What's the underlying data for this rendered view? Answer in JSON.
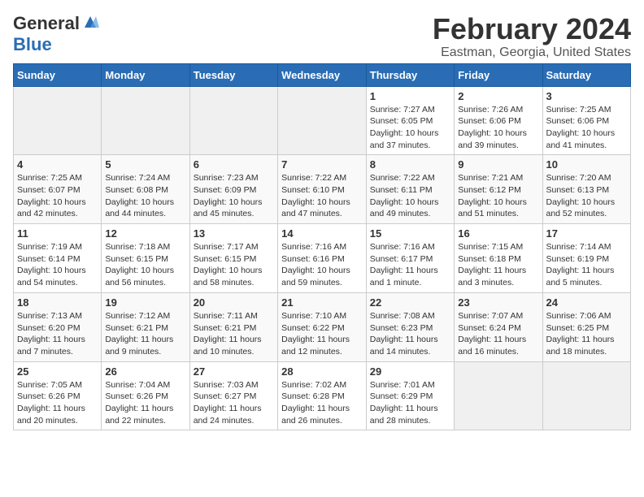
{
  "logo": {
    "general": "General",
    "blue": "Blue"
  },
  "title": "February 2024",
  "subtitle": "Eastman, Georgia, United States",
  "weekdays": [
    "Sunday",
    "Monday",
    "Tuesday",
    "Wednesday",
    "Thursday",
    "Friday",
    "Saturday"
  ],
  "weeks": [
    [
      {
        "day": "",
        "sunrise": "",
        "sunset": "",
        "daylight": ""
      },
      {
        "day": "",
        "sunrise": "",
        "sunset": "",
        "daylight": ""
      },
      {
        "day": "",
        "sunrise": "",
        "sunset": "",
        "daylight": ""
      },
      {
        "day": "",
        "sunrise": "",
        "sunset": "",
        "daylight": ""
      },
      {
        "day": "1",
        "sunrise": "Sunrise: 7:27 AM",
        "sunset": "Sunset: 6:05 PM",
        "daylight": "Daylight: 10 hours and 37 minutes."
      },
      {
        "day": "2",
        "sunrise": "Sunrise: 7:26 AM",
        "sunset": "Sunset: 6:06 PM",
        "daylight": "Daylight: 10 hours and 39 minutes."
      },
      {
        "day": "3",
        "sunrise": "Sunrise: 7:25 AM",
        "sunset": "Sunset: 6:06 PM",
        "daylight": "Daylight: 10 hours and 41 minutes."
      }
    ],
    [
      {
        "day": "4",
        "sunrise": "Sunrise: 7:25 AM",
        "sunset": "Sunset: 6:07 PM",
        "daylight": "Daylight: 10 hours and 42 minutes."
      },
      {
        "day": "5",
        "sunrise": "Sunrise: 7:24 AM",
        "sunset": "Sunset: 6:08 PM",
        "daylight": "Daylight: 10 hours and 44 minutes."
      },
      {
        "day": "6",
        "sunrise": "Sunrise: 7:23 AM",
        "sunset": "Sunset: 6:09 PM",
        "daylight": "Daylight: 10 hours and 45 minutes."
      },
      {
        "day": "7",
        "sunrise": "Sunrise: 7:22 AM",
        "sunset": "Sunset: 6:10 PM",
        "daylight": "Daylight: 10 hours and 47 minutes."
      },
      {
        "day": "8",
        "sunrise": "Sunrise: 7:22 AM",
        "sunset": "Sunset: 6:11 PM",
        "daylight": "Daylight: 10 hours and 49 minutes."
      },
      {
        "day": "9",
        "sunrise": "Sunrise: 7:21 AM",
        "sunset": "Sunset: 6:12 PM",
        "daylight": "Daylight: 10 hours and 51 minutes."
      },
      {
        "day": "10",
        "sunrise": "Sunrise: 7:20 AM",
        "sunset": "Sunset: 6:13 PM",
        "daylight": "Daylight: 10 hours and 52 minutes."
      }
    ],
    [
      {
        "day": "11",
        "sunrise": "Sunrise: 7:19 AM",
        "sunset": "Sunset: 6:14 PM",
        "daylight": "Daylight: 10 hours and 54 minutes."
      },
      {
        "day": "12",
        "sunrise": "Sunrise: 7:18 AM",
        "sunset": "Sunset: 6:15 PM",
        "daylight": "Daylight: 10 hours and 56 minutes."
      },
      {
        "day": "13",
        "sunrise": "Sunrise: 7:17 AM",
        "sunset": "Sunset: 6:15 PM",
        "daylight": "Daylight: 10 hours and 58 minutes."
      },
      {
        "day": "14",
        "sunrise": "Sunrise: 7:16 AM",
        "sunset": "Sunset: 6:16 PM",
        "daylight": "Daylight: 10 hours and 59 minutes."
      },
      {
        "day": "15",
        "sunrise": "Sunrise: 7:16 AM",
        "sunset": "Sunset: 6:17 PM",
        "daylight": "Daylight: 11 hours and 1 minute."
      },
      {
        "day": "16",
        "sunrise": "Sunrise: 7:15 AM",
        "sunset": "Sunset: 6:18 PM",
        "daylight": "Daylight: 11 hours and 3 minutes."
      },
      {
        "day": "17",
        "sunrise": "Sunrise: 7:14 AM",
        "sunset": "Sunset: 6:19 PM",
        "daylight": "Daylight: 11 hours and 5 minutes."
      }
    ],
    [
      {
        "day": "18",
        "sunrise": "Sunrise: 7:13 AM",
        "sunset": "Sunset: 6:20 PM",
        "daylight": "Daylight: 11 hours and 7 minutes."
      },
      {
        "day": "19",
        "sunrise": "Sunrise: 7:12 AM",
        "sunset": "Sunset: 6:21 PM",
        "daylight": "Daylight: 11 hours and 9 minutes."
      },
      {
        "day": "20",
        "sunrise": "Sunrise: 7:11 AM",
        "sunset": "Sunset: 6:21 PM",
        "daylight": "Daylight: 11 hours and 10 minutes."
      },
      {
        "day": "21",
        "sunrise": "Sunrise: 7:10 AM",
        "sunset": "Sunset: 6:22 PM",
        "daylight": "Daylight: 11 hours and 12 minutes."
      },
      {
        "day": "22",
        "sunrise": "Sunrise: 7:08 AM",
        "sunset": "Sunset: 6:23 PM",
        "daylight": "Daylight: 11 hours and 14 minutes."
      },
      {
        "day": "23",
        "sunrise": "Sunrise: 7:07 AM",
        "sunset": "Sunset: 6:24 PM",
        "daylight": "Daylight: 11 hours and 16 minutes."
      },
      {
        "day": "24",
        "sunrise": "Sunrise: 7:06 AM",
        "sunset": "Sunset: 6:25 PM",
        "daylight": "Daylight: 11 hours and 18 minutes."
      }
    ],
    [
      {
        "day": "25",
        "sunrise": "Sunrise: 7:05 AM",
        "sunset": "Sunset: 6:26 PM",
        "daylight": "Daylight: 11 hours and 20 minutes."
      },
      {
        "day": "26",
        "sunrise": "Sunrise: 7:04 AM",
        "sunset": "Sunset: 6:26 PM",
        "daylight": "Daylight: 11 hours and 22 minutes."
      },
      {
        "day": "27",
        "sunrise": "Sunrise: 7:03 AM",
        "sunset": "Sunset: 6:27 PM",
        "daylight": "Daylight: 11 hours and 24 minutes."
      },
      {
        "day": "28",
        "sunrise": "Sunrise: 7:02 AM",
        "sunset": "Sunset: 6:28 PM",
        "daylight": "Daylight: 11 hours and 26 minutes."
      },
      {
        "day": "29",
        "sunrise": "Sunrise: 7:01 AM",
        "sunset": "Sunset: 6:29 PM",
        "daylight": "Daylight: 11 hours and 28 minutes."
      },
      {
        "day": "",
        "sunrise": "",
        "sunset": "",
        "daylight": ""
      },
      {
        "day": "",
        "sunrise": "",
        "sunset": "",
        "daylight": ""
      }
    ]
  ]
}
